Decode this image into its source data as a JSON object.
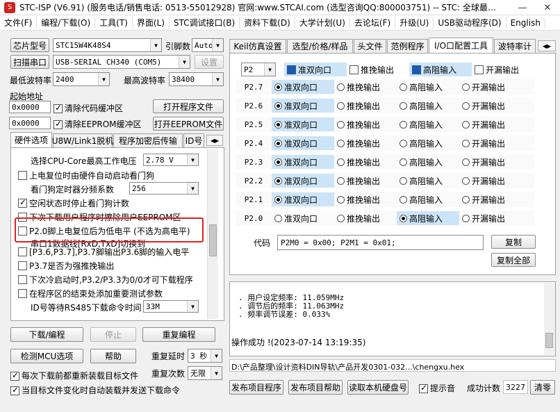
{
  "title_bar": {
    "title": "STC-ISP (V6.91) (服务电话/销售电话: 0513-55012928) 官网:www.STCAI.com  (选型咨询QQ:800003751) -- STC: 全球最…",
    "minimize": "—",
    "close": "✕"
  },
  "menu": [
    "文件(F)",
    "编程/下载(O)",
    "工具(T)",
    "界面(L)",
    "STC调试接口(B)",
    "资料下载(D)",
    "大学计划(U)",
    "去论坛(F)",
    "升级(U)",
    "USB驱动程序(D)",
    "English"
  ],
  "left": {
    "chip_model_btn": "芯片型号",
    "chip_model_value": "STC15W4K48S4",
    "pin_count_label": "引脚数",
    "pin_count_value": "Auto",
    "scan_port_btn": "扫描串口",
    "port_value": "USB-SERIAL CH340 (COM5)",
    "settings_btn": "设置",
    "min_baud_label": "最低波特率",
    "min_baud_value": "2400",
    "max_baud_label": "最高波特率",
    "max_baud_value": "38400",
    "start_addr_label": "起始地址",
    "addr1": "0x0000",
    "clear_code_label": "清除代码缓冲区",
    "open_program_btn": "打开程序文件",
    "addr2": "0x0000",
    "clear_eeprom_label": "清除EEPROM缓冲区",
    "open_eeprom_btn": "打开EEPROM文件",
    "tabs": [
      "硬件选项",
      "U8W/Link1脱机",
      "程序加密后传输",
      "ID号"
    ],
    "hw": {
      "cpu_voltage_label": "选择CPU-Core最高工作电压",
      "cpu_voltage_value": "2.78 V",
      "watchdog_label": "上电复位时由硬件自动启动看门狗",
      "wdt_div_label": "看门狗定时器分频系数",
      "wdt_div_value": "256",
      "idle_wdt_label": "空闲状态时停止看门狗计数",
      "eeprom_erase_label": "下次下载用户程序时擦除用户EEPROM区",
      "p20_label": "P2.0脚上电复位后为低电平 (不选为高电平)",
      "uart_switch_label": "串口1数据线[RxD,TxD]切换到",
      "uart_switch_label2": "[P3.6,P3.7],P3.7脚输出P3.6脚的输入电平",
      "p37_label": "P3.7是否为强推挽输出",
      "cold_boot_label": "下次冷启动时,P3.2/P3.3为0/0才可下载程序",
      "add_params_label": "在程序区的结束处添加重要测试参数",
      "rs485_label": "ID号等待RS485下载命令时间",
      "rs485_value": "33M"
    },
    "download_btn": "下载/编程",
    "stop_btn": "停止",
    "reprogram_btn": "重复编程",
    "detect_btn": "检测MCU选项",
    "help_btn": "帮助",
    "repeat_delay_label": "重复延时",
    "repeat_delay_value": "3 秒",
    "repeat_count_label": "重复次数",
    "repeat_count_value": "无限",
    "reload_label": "每次下载前都重新装载目标文件",
    "auto_send_label": "当目标文件变化时自动装载并发送下载命令"
  },
  "right": {
    "tabs": [
      "Keil仿真设置",
      "选型/价格/样品",
      "头文件",
      "范例程序",
      "I/O口配置工具",
      "波特率计"
    ],
    "port_select": "P2",
    "headers": [
      "准双向口",
      "推挽输出",
      "高阻输入",
      "开漏输出"
    ],
    "rows": [
      {
        "pin": "P2.7",
        "sel": 0
      },
      {
        "pin": "P2.6",
        "sel": 0
      },
      {
        "pin": "P2.5",
        "sel": 0
      },
      {
        "pin": "P2.4",
        "sel": 0
      },
      {
        "pin": "P2.3",
        "sel": 0
      },
      {
        "pin": "P2.2",
        "sel": 0
      },
      {
        "pin": "P2.1",
        "sel": 0
      },
      {
        "pin": "P2.0",
        "sel": 2
      }
    ],
    "code_label": "代码",
    "code_value": "P2M0 = 0x00;  P2M1 = 0x01;",
    "copy_btn": "复制",
    "copy_all_btn": "复制全部",
    "log_lines": [
      ". 用户设定频率: 11.059MHz",
      ". 调节后的频率: 11.063MHz",
      ". 频率调节误差: 0.033%"
    ],
    "log_status": "操作成功 !(2023-07-14 13:19:35)",
    "file_path": "D:\\产品整理\\设计资料DIN导轨\\产品开发0301-032...\\chengxu.hex",
    "publish_btn": "发布项目程序",
    "publish_help_btn": "发布项目帮助",
    "read_disk_btn": "读取本机硬盘号",
    "beep_label": "提示音",
    "success_count_label": "成功计数",
    "success_count_value": "3227",
    "clear_btn": "清零"
  },
  "colors": {
    "highlight": "#cce4f7",
    "annotation": "#e02020",
    "selected_tab_bg": "#ffffff"
  }
}
